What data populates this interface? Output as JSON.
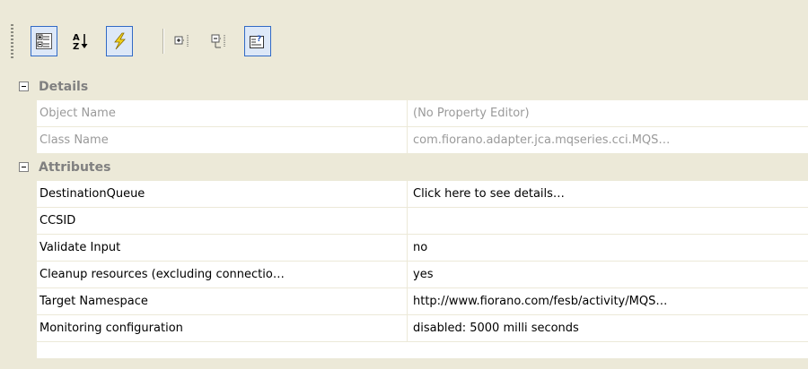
{
  "toolbar": {
    "buttons": [
      {
        "name": "categorized-view",
        "checked": true
      },
      {
        "name": "alphabetical-sort",
        "checked": false
      },
      {
        "name": "events-view",
        "checked": true
      },
      {
        "name": "expand-all",
        "checked": false
      },
      {
        "name": "collapse-all",
        "checked": false
      },
      {
        "name": "property-pages",
        "checked": true
      }
    ]
  },
  "categories": [
    {
      "label": "Details",
      "expanded": true,
      "properties": [
        {
          "name": "Object Name",
          "value": "(No Property Editor)",
          "readonly": true
        },
        {
          "name": "Class Name",
          "value": "com.fiorano.adapter.jca.mqseries.cci.MQS…",
          "readonly": true
        }
      ]
    },
    {
      "label": "Attributes",
      "expanded": true,
      "properties": [
        {
          "name": "DestinationQueue",
          "value": "Click here to see details…",
          "readonly": false
        },
        {
          "name": "CCSID",
          "value": "",
          "readonly": false
        },
        {
          "name": "Validate Input",
          "value": "no",
          "readonly": false
        },
        {
          "name": "Cleanup resources (excluding connectio…",
          "value": "yes",
          "readonly": false
        },
        {
          "name": "Target Namespace",
          "value": "http://www.fiorano.com/fesb/activity/MQS…",
          "readonly": false
        },
        {
          "name": "Monitoring configuration",
          "value": "disabled: 5000 milli seconds",
          "readonly": false
        }
      ]
    }
  ],
  "colors": {
    "chrome": "#ece9d8",
    "readonly_text": "#9a9a9a",
    "selection_border": "#316ac5"
  }
}
